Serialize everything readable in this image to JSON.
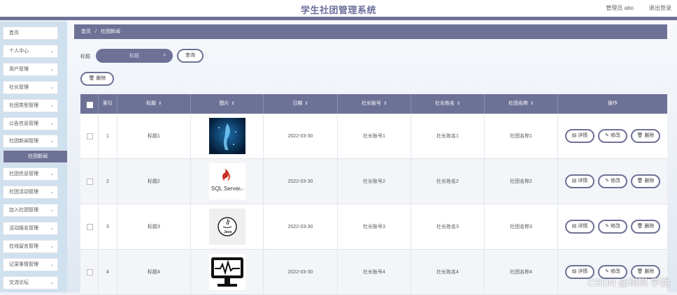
{
  "header": {
    "title": "学生社团管理系统",
    "user": "管理员 abo",
    "logout": "退出登录"
  },
  "sidebar": {
    "items": [
      {
        "label": "首页",
        "chevron": false
      },
      {
        "label": "个人中心",
        "chevron": true
      },
      {
        "label": "用户管理",
        "chevron": true
      },
      {
        "label": "社长管理",
        "chevron": true
      },
      {
        "label": "社团类型管理",
        "chevron": true
      },
      {
        "label": "公告信息管理",
        "chevron": true
      },
      {
        "label": "社团新闻管理",
        "chevron": true
      },
      {
        "label": "社团新闻",
        "active": true
      },
      {
        "label": "社团信息管理",
        "chevron": true
      },
      {
        "label": "社团活动管理",
        "chevron": true
      },
      {
        "label": "加入社团管理",
        "chevron": true
      },
      {
        "label": "活动报名管理",
        "chevron": true
      },
      {
        "label": "在线留言管理",
        "chevron": true
      },
      {
        "label": "记录事情管理",
        "chevron": true
      },
      {
        "label": "交流论坛",
        "chevron": true
      }
    ]
  },
  "breadcrumb": {
    "home": "首页",
    "sep": "/",
    "current": "社团新闻"
  },
  "search": {
    "label": "标题",
    "placeholder": "标题",
    "button": "查询"
  },
  "toolbar": {
    "delete": "删除"
  },
  "table": {
    "columns": [
      "",
      "索引",
      "标题",
      "图片",
      "日期",
      "社长账号",
      "社长姓名",
      "社团名称",
      "操作"
    ],
    "rows": [
      {
        "index": "1",
        "title": "标题1",
        "image": "blue-figure-image",
        "date": "2022-03-30",
        "account": "社长账号1",
        "name": "社长姓名1",
        "club": "社团名称1"
      },
      {
        "index": "2",
        "title": "标题2",
        "image": "sql-server-logo",
        "date": "2022-03-30",
        "account": "社长账号2",
        "name": "社长姓名2",
        "club": "社团名称2"
      },
      {
        "index": "3",
        "title": "标题3",
        "image": "java-logo",
        "date": "2022-03-30",
        "account": "社长账号3",
        "name": "社长姓名3",
        "club": "社团名称3"
      },
      {
        "index": "4",
        "title": "标题4",
        "image": "monitor-icon",
        "date": "2022-03-30",
        "account": "社长账号4",
        "name": "社长姓名4",
        "club": "社团名称4"
      }
    ],
    "actions": {
      "detail": "详情",
      "edit": "修改",
      "delete": "删除"
    }
  },
  "watermark": "CSDN @琪琪 学姐",
  "theme": {
    "accent": "#6e7196",
    "sidebar_bg": "#cfe0ef"
  }
}
